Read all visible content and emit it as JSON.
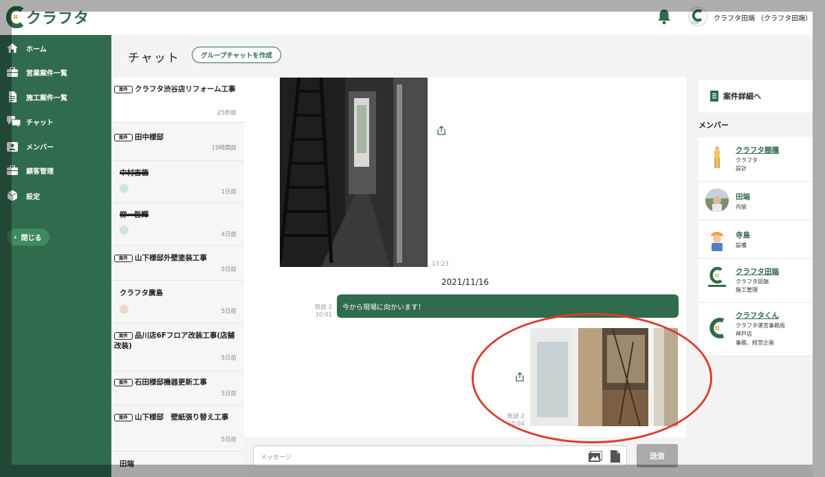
{
  "header": {
    "logo_text": "クラフタ",
    "user_name": "クラフタ田端 （クラフタ田端）",
    "avatar_text": "ｸﾗﾌﾀ",
    "accent": "#316b4d"
  },
  "sidebar": {
    "items": [
      {
        "label": "ホーム",
        "icon": "home-icon"
      },
      {
        "label": "営業案件一覧",
        "icon": "briefcase-icon"
      },
      {
        "label": "施工案件一覧",
        "icon": "document-icon"
      },
      {
        "label": "チャット",
        "icon": "chat-icon"
      },
      {
        "label": "メンバー",
        "icon": "member-icon"
      },
      {
        "label": "顧客管理",
        "icon": "customer-icon"
      },
      {
        "label": "設定",
        "icon": "settings-icon"
      }
    ],
    "close_label": "閉じる"
  },
  "chat": {
    "title": "チャット",
    "group_button": "グループチャットを作成"
  },
  "conversations": [
    {
      "tag": "案件",
      "title": "クラフタ渋谷店リフォーム工事",
      "time": "25秒前"
    },
    {
      "tag": "案件",
      "title": "田中様邸",
      "time": "19時間前"
    },
    {
      "tag": "",
      "title": "中村吉徳",
      "time": "1日前"
    },
    {
      "tag": "",
      "title": "柳一哲輝",
      "time": "4日前"
    },
    {
      "tag": "案件",
      "title": "山下様邸外壁塗装工事",
      "time": "5日前"
    },
    {
      "tag": "",
      "title": "クラフタ廣島",
      "time": "5日前"
    },
    {
      "tag": "案件",
      "title": "品川店6Fフロア改装工事(店舗改装)",
      "time": "5日前"
    },
    {
      "tag": "案件",
      "title": "石田様邸機器更新工事",
      "time": "5日前"
    },
    {
      "tag": "案件",
      "title": "山下様邸　壁紙張り替え工事",
      "time": "5日前"
    },
    {
      "tag": "",
      "title": "田端",
      "time": ""
    }
  ],
  "messages": {
    "photo1_time": "13:23",
    "date_separator": "2021/11/16",
    "text_read": "既読 2",
    "text_time": "10:01",
    "text_body": "今から現場に向かいます！",
    "photo2_read": "既読 2",
    "photo2_time": "10:04"
  },
  "input": {
    "placeholder": "メッセージ",
    "send_label": "送信"
  },
  "right_panel": {
    "detail_link": "案件詳細へ",
    "members_title": "メンバー",
    "members": [
      {
        "name": "クラフタ棚橋",
        "lines": [
          "クラフタ",
          "設計"
        ],
        "underline": true
      },
      {
        "name": "田端",
        "lines": [
          "内装"
        ],
        "underline": false
      },
      {
        "name": "寺島",
        "lines": [
          "設備"
        ],
        "underline": false
      },
      {
        "name": "クラフタ田端",
        "lines": [
          "クラフタ田端",
          "施工管理"
        ],
        "underline": true
      },
      {
        "name": "クラフタくん",
        "lines": [
          "クラフタ運営事務局",
          "神戸店",
          "事務，経営企画"
        ],
        "underline": true
      }
    ]
  }
}
